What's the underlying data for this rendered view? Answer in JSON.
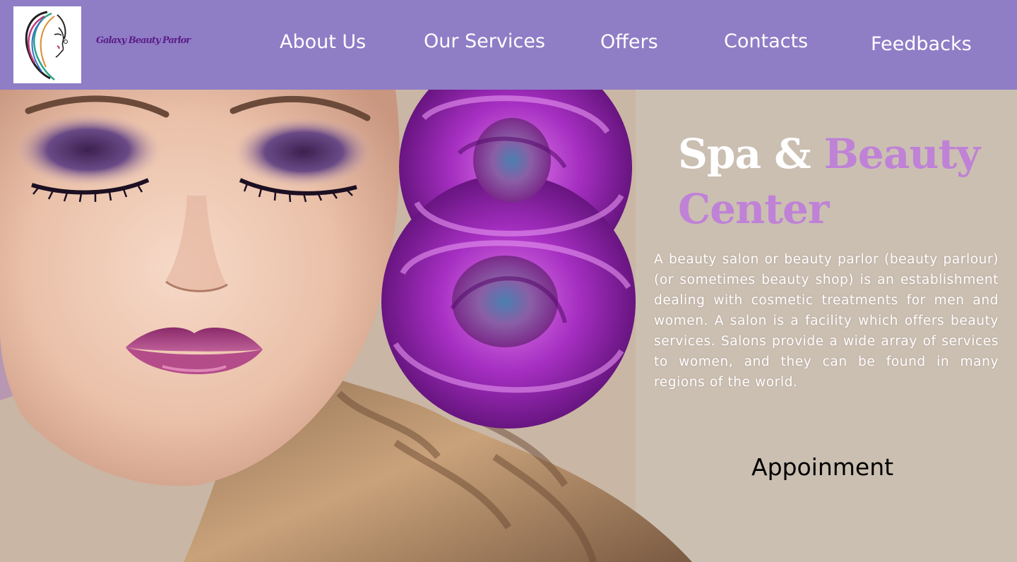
{
  "header": {
    "brand": "Galaxy Beauty Parlor",
    "nav": {
      "about": "About Us",
      "services": "Our Services",
      "offers": "Offers",
      "contacts": "Contacts",
      "feedbacks": "Feedbacks"
    }
  },
  "hero": {
    "headline_part1": "Spa & ",
    "headline_part2": "Beauty Center",
    "description": "A beauty salon or beauty parlor (beauty parlour) (or sometimes beauty shop) is an establishment dealing with cosmetic treatments for men and women. A salon is a facility which offers beauty services. Salons provide a wide array of services to women, and they can be found in many regions of the world.",
    "cta": "Appoinment"
  },
  "colors": {
    "header_bg": "#8f7dc6",
    "brand_text": "#5b1e86",
    "accent_lilac": "#bf82d6",
    "rose_purple": "#a62fc2"
  }
}
